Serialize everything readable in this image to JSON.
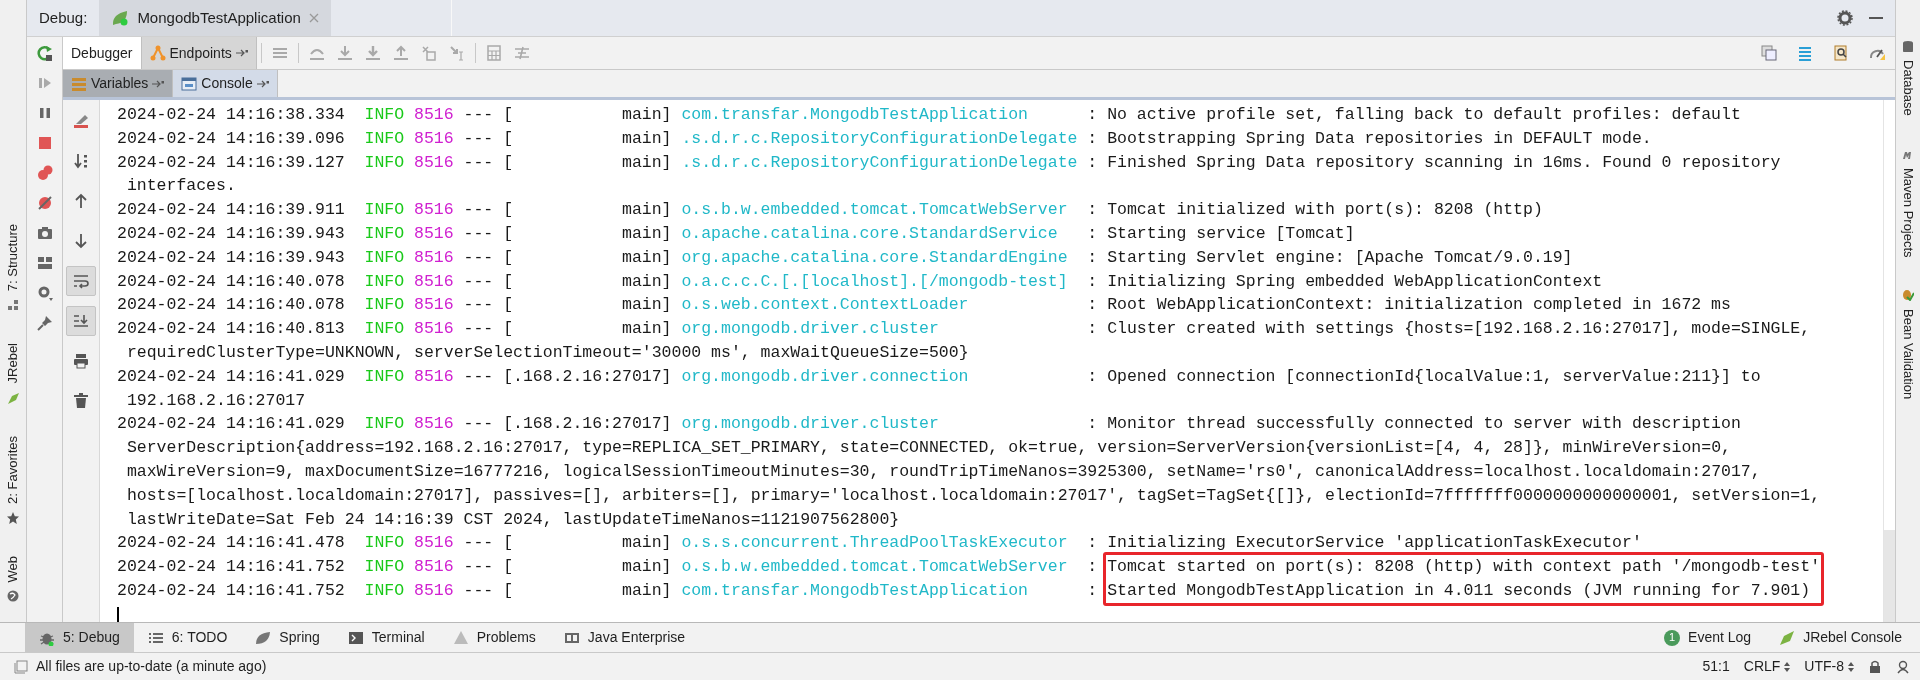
{
  "debug_window": {
    "title": "Debug:",
    "session_tab": {
      "label": "MongodbTestApplication",
      "selected": true
    }
  },
  "toolbar_tabs": [
    {
      "label": "Debugger",
      "selected": true
    },
    {
      "label": "Endpoints",
      "selected": false
    }
  ],
  "content_tabs": [
    {
      "label": "Variables",
      "selected": false
    },
    {
      "label": "Console",
      "selected": true
    }
  ],
  "console_toggles": {
    "soft_wrap_on": true,
    "scroll_to_end_on": true
  },
  "log": [
    {
      "timestamp": "2024-02-24 14:16:38.334",
      "level": "INFO",
      "pid": "8516",
      "separator": "---",
      "thread": "[           main]",
      "logger": "com.transfar.MongodbTestApplication",
      "colon": ":",
      "lines": [
        "No active profile set, falling back to default profiles: default"
      ],
      "highlighted": false
    },
    {
      "timestamp": "2024-02-24 14:16:39.096",
      "level": "INFO",
      "pid": "8516",
      "separator": "---",
      "thread": "[           main]",
      "logger": ".s.d.r.c.RepositoryConfigurationDelegate",
      "colon": ":",
      "lines": [
        "Bootstrapping Spring Data repositories in DEFAULT mode."
      ],
      "highlighted": false
    },
    {
      "timestamp": "2024-02-24 14:16:39.127",
      "level": "INFO",
      "pid": "8516",
      "separator": "---",
      "thread": "[           main]",
      "logger": ".s.d.r.c.RepositoryConfigurationDelegate",
      "colon": ":",
      "lines": [
        "Finished Spring Data repository scanning in 16ms. Found 0 repository",
        "interfaces."
      ],
      "highlighted": false
    },
    {
      "timestamp": "2024-02-24 14:16:39.911",
      "level": "INFO",
      "pid": "8516",
      "separator": "---",
      "thread": "[           main]",
      "logger": "o.s.b.w.embedded.tomcat.TomcatWebServer",
      "colon": ":",
      "lines": [
        "Tomcat initialized with port(s): 8208 (http)"
      ],
      "highlighted": false
    },
    {
      "timestamp": "2024-02-24 14:16:39.943",
      "level": "INFO",
      "pid": "8516",
      "separator": "---",
      "thread": "[           main]",
      "logger": "o.apache.catalina.core.StandardService",
      "colon": ":",
      "lines": [
        "Starting service [Tomcat]"
      ],
      "highlighted": false
    },
    {
      "timestamp": "2024-02-24 14:16:39.943",
      "level": "INFO",
      "pid": "8516",
      "separator": "---",
      "thread": "[           main]",
      "logger": "org.apache.catalina.core.StandardEngine",
      "colon": ":",
      "lines": [
        "Starting Servlet engine: [Apache Tomcat/9.0.19]"
      ],
      "highlighted": false
    },
    {
      "timestamp": "2024-02-24 14:16:40.078",
      "level": "INFO",
      "pid": "8516",
      "separator": "---",
      "thread": "[           main]",
      "logger": "o.a.c.c.C.[.[localhost].[/mongodb-test]",
      "colon": ":",
      "lines": [
        "Initializing Spring embedded WebApplicationContext"
      ],
      "highlighted": false
    },
    {
      "timestamp": "2024-02-24 14:16:40.078",
      "level": "INFO",
      "pid": "8516",
      "separator": "---",
      "thread": "[           main]",
      "logger": "o.s.web.context.ContextLoader",
      "colon": ":",
      "lines": [
        "Root WebApplicationContext: initialization completed in 1672 ms"
      ],
      "highlighted": false
    },
    {
      "timestamp": "2024-02-24 14:16:40.813",
      "level": "INFO",
      "pid": "8516",
      "separator": "---",
      "thread": "[           main]",
      "logger": "org.mongodb.driver.cluster",
      "colon": ":",
      "lines": [
        "Cluster created with settings {hosts=[192.168.2.16:27017], mode=SINGLE,",
        "requiredClusterType=UNKNOWN, serverSelectionTimeout='30000 ms', maxWaitQueueSize=500}"
      ],
      "highlighted": false
    },
    {
      "timestamp": "2024-02-24 14:16:41.029",
      "level": "INFO",
      "pid": "8516",
      "separator": "---",
      "thread": "[.168.2.16:27017]",
      "logger": "org.mongodb.driver.connection",
      "colon": ":",
      "lines": [
        "Opened connection [connectionId{localValue:1, serverValue:211}] to",
        "192.168.2.16:27017"
      ],
      "highlighted": false
    },
    {
      "timestamp": "2024-02-24 14:16:41.029",
      "level": "INFO",
      "pid": "8516",
      "separator": "---",
      "thread": "[.168.2.16:27017]",
      "logger": "org.mongodb.driver.cluster",
      "colon": ":",
      "lines": [
        "Monitor thread successfully connected to server with description",
        "ServerDescription{address=192.168.2.16:27017, type=REPLICA_SET_PRIMARY, state=CONNECTED, ok=true, version=ServerVersion{versionList=[4, 4, 28]}, minWireVersion=0,",
        "maxWireVersion=9, maxDocumentSize=16777216, logicalSessionTimeoutMinutes=30, roundTripTimeNanos=3925300, setName='rs0', canonicalAddress=localhost.localdomain:27017,",
        "hosts=[localhost.localdomain:27017], passives=[], arbiters=[], primary='localhost.localdomain:27017', tagSet=TagSet{[]}, electionId=7fffffff0000000000000001, setVersion=1,",
        "lastWriteDate=Sat Feb 24 14:16:39 CST 2024, lastUpdateTimeNanos=1121907562800}"
      ],
      "highlighted": false
    },
    {
      "timestamp": "2024-02-24 14:16:41.478",
      "level": "INFO",
      "pid": "8516",
      "separator": "---",
      "thread": "[           main]",
      "logger": "o.s.s.concurrent.ThreadPoolTaskExecutor",
      "colon": ":",
      "lines": [
        "Initializing ExecutorService 'applicationTaskExecutor'"
      ],
      "highlighted": false
    },
    {
      "timestamp": "2024-02-24 14:16:41.752",
      "level": "INFO",
      "pid": "8516",
      "separator": "---",
      "thread": "[           main]",
      "logger": "o.s.b.w.embedded.tomcat.TomcatWebServer",
      "colon": ":",
      "lines": [
        "Tomcat started on port(s): 8208 (http) with context path '/mongodb-test'"
      ],
      "highlighted": true
    },
    {
      "timestamp": "2024-02-24 14:16:41.752",
      "level": "INFO",
      "pid": "8516",
      "separator": "---",
      "thread": "[           main]",
      "logger": "com.transfar.MongodbTestApplication",
      "colon": ":",
      "lines": [
        "Started MongodbTestApplication in 4.011 seconds (JVM running for 7.901)"
      ],
      "highlighted": true
    }
  ],
  "left_stripe": [
    {
      "label": "7: Structure",
      "kind": "structure"
    },
    {
      "label": "JRebel",
      "kind": "jrebel"
    },
    {
      "label": "2: Favorites",
      "kind": "favorites"
    },
    {
      "label": "Web",
      "kind": "web"
    }
  ],
  "right_stripe": [
    {
      "label": "Database",
      "kind": "database"
    },
    {
      "label": "Maven Projects",
      "kind": "maven"
    },
    {
      "label": "Bean Validation",
      "kind": "bean"
    }
  ],
  "bottom_tabs": [
    {
      "label": "5: Debug",
      "kind": "debug",
      "selected": true
    },
    {
      "label": "6: TODO",
      "kind": "todo",
      "selected": false
    },
    {
      "label": "Spring",
      "kind": "spring",
      "selected": false
    },
    {
      "label": "Terminal",
      "kind": "terminal",
      "selected": false
    },
    {
      "label": "Problems",
      "kind": "problems",
      "selected": false
    },
    {
      "label": "Java Enterprise",
      "kind": "javaee",
      "selected": false
    }
  ],
  "bottom_right_tabs": [
    {
      "label": "Event Log",
      "kind": "eventlog",
      "badge": "1"
    },
    {
      "label": "JRebel Console",
      "kind": "jrebel"
    }
  ],
  "status_bar": {
    "message": "All files are up-to-date (a minute ago)",
    "position": "51:1",
    "line_separator": "CRLF",
    "encoding": "UTF-8"
  }
}
